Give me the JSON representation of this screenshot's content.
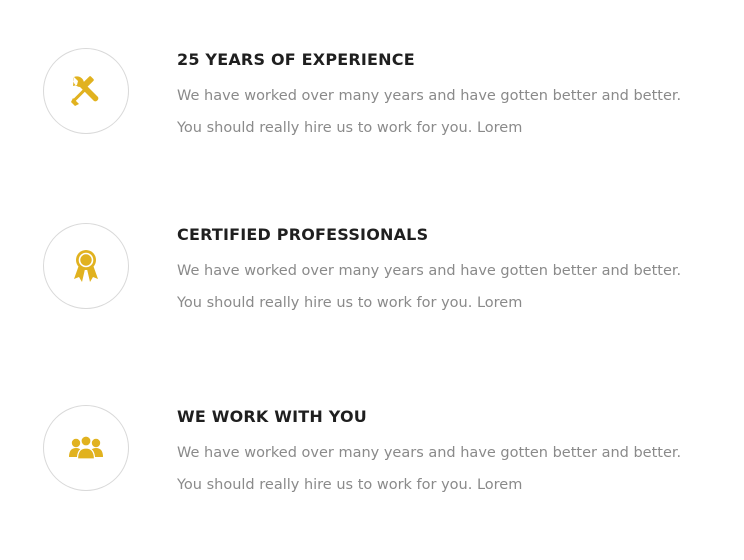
{
  "accent_color": "#e1b21f",
  "features": [
    {
      "icon": "tools-icon",
      "title": "25 YEARS OF EXPERIENCE",
      "line1": "We have worked over many years and have gotten better and better.",
      "line2": "You should really hire us to work for you. Lorem"
    },
    {
      "icon": "award-ribbon-icon",
      "title": "CERTIFIED PROFESSIONALS",
      "line1": "We have worked over many years and have gotten better and better.",
      "line2": "You should really hire us to work for you. Lorem"
    },
    {
      "icon": "team-icon",
      "title": "WE WORK WITH YOU",
      "line1": "We have worked over many years and have gotten better and better.",
      "line2": "You should really hire us to work for you. Lorem"
    }
  ]
}
